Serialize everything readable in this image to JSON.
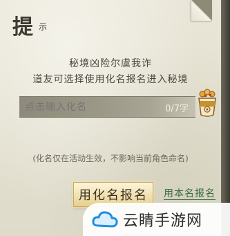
{
  "dialog": {
    "title": "提",
    "title_sub": "示",
    "description": [
      "秘境凶险尔虞我诈",
      "道友可选择使用化名报名进入秘境"
    ],
    "input": {
      "placeholder": "点击输入化名",
      "value": ""
    },
    "char_count": "0/7字",
    "random_name_icon": "dice-cup-icon",
    "note": "(化名仅在活动生效，不影响当前角色命名)",
    "primary_button": "用化名报名",
    "secondary_link": "用本名报名"
  },
  "watermark": {
    "text": "云睛手游网",
    "icon": "cloud-logo-icon"
  },
  "colors": {
    "paper": "#e6e3d4",
    "input_bar": "#9a9686",
    "link": "#3a6b3f",
    "button_gold": "#f1e2b1"
  }
}
